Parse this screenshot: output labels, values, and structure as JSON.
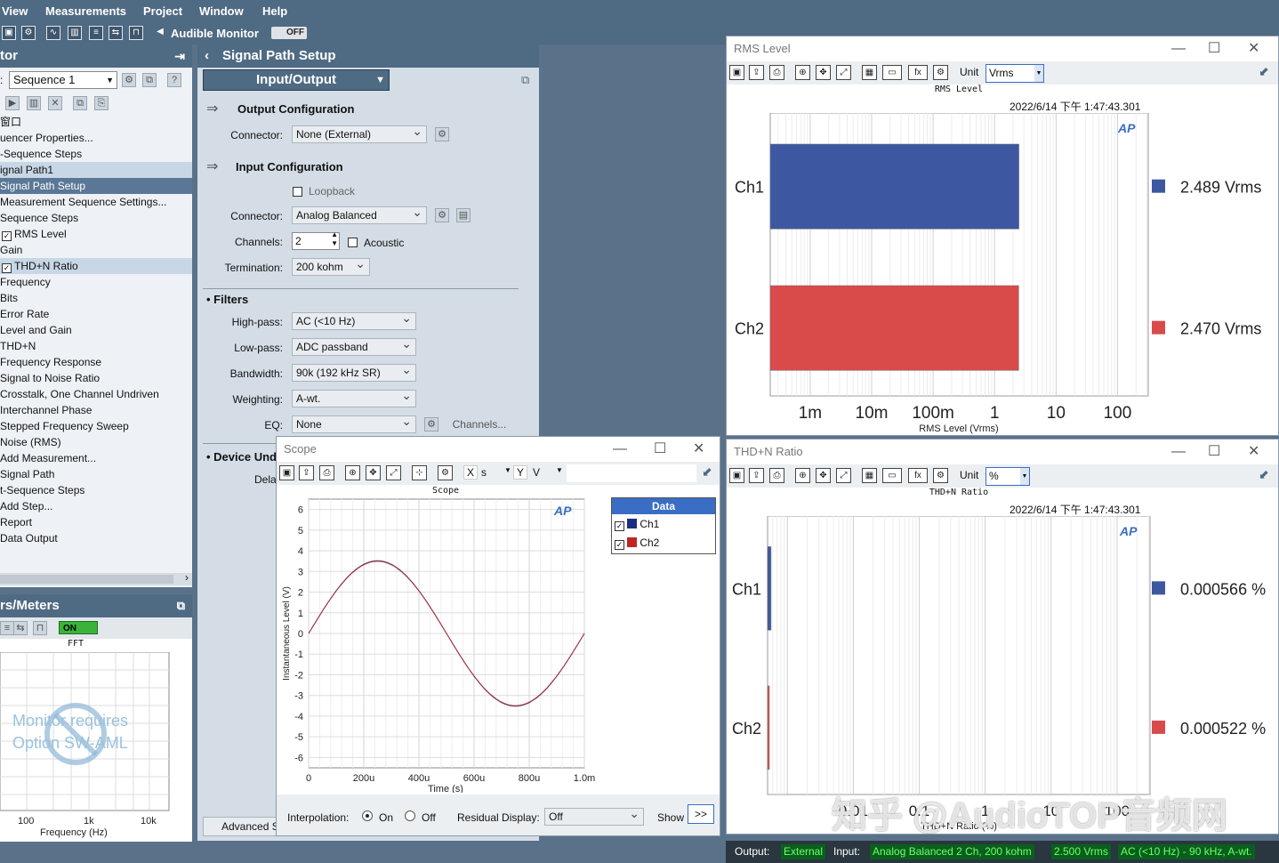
{
  "menu": {
    "items": [
      "View",
      "Measurements",
      "Project",
      "Window",
      "Help"
    ]
  },
  "toolbar": {
    "audible_monitor": "Audible Monitor",
    "off": "OFF"
  },
  "navigator": {
    "title": "tor",
    "sequence_label": ":",
    "sequence_value": "Sequence 1",
    "items": [
      {
        "text": "窗口",
        "cls": ""
      },
      {
        "text": "uencer Properties...",
        "cls": ""
      },
      {
        "text": "-Sequence Steps",
        "cls": ""
      },
      {
        "text": "ignal Path1",
        "cls": "sel"
      },
      {
        "text": "Signal Path Setup",
        "cls": "hl"
      },
      {
        "text": "Measurement Sequence Settings...",
        "cls": ""
      },
      {
        "text": "Sequence Steps",
        "cls": ""
      },
      {
        "text": "RMS Level",
        "cls": "",
        "check": true
      },
      {
        "text": "Gain",
        "cls": ""
      },
      {
        "text": "THD+N Ratio",
        "cls": "sel",
        "check": true
      },
      {
        "text": "Frequency",
        "cls": ""
      },
      {
        "text": "Bits",
        "cls": ""
      },
      {
        "text": "Error Rate",
        "cls": ""
      },
      {
        "text": "Level and Gain",
        "cls": ""
      },
      {
        "text": "THD+N",
        "cls": ""
      },
      {
        "text": "Frequency Response",
        "cls": ""
      },
      {
        "text": "Signal to Noise Ratio",
        "cls": ""
      },
      {
        "text": "Crosstalk, One Channel Undriven",
        "cls": ""
      },
      {
        "text": "Interchannel Phase",
        "cls": ""
      },
      {
        "text": "Stepped Frequency Sweep",
        "cls": ""
      },
      {
        "text": "Noise (RMS)",
        "cls": ""
      },
      {
        "text": "Add Measurement...",
        "cls": ""
      },
      {
        "text": "Signal Path",
        "cls": ""
      },
      {
        "text": "t-Sequence Steps",
        "cls": ""
      },
      {
        "text": "Add Step...",
        "cls": ""
      },
      {
        "text": "Report",
        "cls": ""
      },
      {
        "text": "Data Output",
        "cls": ""
      }
    ]
  },
  "meters": {
    "title": "rs/Meters",
    "on": "ON",
    "fft_title": "FFT",
    "warning_line1": "Monitor requires",
    "warning_line2": "Option SW-AML",
    "x_ticks": [
      "100",
      "1k",
      "10k"
    ],
    "xlabel": "Frequency (Hz)"
  },
  "signal_path": {
    "title": "Signal Path Setup",
    "io_select": "Input/Output",
    "output_config": "Output Configuration",
    "connector_label": "Connector:",
    "output_connector": "None (External)",
    "input_config": "Input Configuration",
    "loopback": "Loopback",
    "input_connector": "Analog Balanced",
    "channels_label": "Channels:",
    "channels_value": "2",
    "acoustic": "Acoustic",
    "termination_label": "Termination:",
    "termination_value": "200 kohm",
    "filters": "Filters",
    "highpass_label": "High-pass:",
    "highpass_value": "AC (<10 Hz)",
    "lowpass_label": "Low-pass:",
    "lowpass_value": "ADC passband",
    "bandwidth_label": "Bandwidth:",
    "bandwidth_value": "90k (192 kHz SR)",
    "weighting_label": "Weighting:",
    "weighting_value": "A-wt.",
    "eq_label": "EQ:",
    "eq_value": "None",
    "channels_btn": "Channels...",
    "device_under": "Device Und",
    "delay_label": "Dela",
    "advanced": "Advanced S"
  },
  "rms_window": {
    "title": "RMS Level",
    "unit_label": "Unit",
    "unit_value": "Vrms",
    "plot_title": "RMS Level",
    "timestamp": "2022/6/14 下午 1:47:43.301",
    "xlabel": "RMS Level (Vrms)"
  },
  "thd_window": {
    "title": "THD+N Ratio",
    "unit_label": "Unit",
    "unit_value": "%",
    "plot_title": "THD+N Ratio",
    "timestamp": "2022/6/14 下午 1:47:43.301",
    "xlabel": "THD+N Ratio (%)",
    "watermark": "知乎 @AudioTOP音频网"
  },
  "scope_window": {
    "title": "Scope",
    "plot_title": "Scope",
    "x_unit_label": "X",
    "x_unit": "s",
    "y_unit_label": "Y",
    "y_unit": "V",
    "ylabel": "Instantaneous Level (V)",
    "xlabel": "Time (s)",
    "legend_title": "Data",
    "legend": [
      "Ch1",
      "Ch2"
    ],
    "interpolation_label": "Interpolation:",
    "on": "On",
    "off": "Off",
    "residual_label": "Residual Display:",
    "residual_value": "Off",
    "show": "Show",
    "more": ">>"
  },
  "status": {
    "output_label": "Output:",
    "output_value": "External",
    "input_label": "Input:",
    "input_value": "Analog Balanced 2 Ch, 200 kohm",
    "level": "2.500 Vrms",
    "filter": "AC (<10 Hz) - 90 kHz, A-wt."
  },
  "chart_data": [
    {
      "type": "bar",
      "title": "RMS Level",
      "orientation": "horizontal",
      "categories": [
        "Ch1",
        "Ch2"
      ],
      "values": [
        2.489,
        2.47
      ],
      "value_labels": [
        "2.489 Vrms",
        "2.470 Vrms"
      ],
      "colors": [
        "#3d57a0",
        "#d94a4a"
      ],
      "xscale": "log",
      "xlim": [
        0.0001,
        316
      ],
      "x_ticks": [
        "1m",
        "10m",
        "100m",
        "1",
        "10",
        "100"
      ],
      "x_tick_values": [
        0.001,
        0.01,
        0.1,
        1,
        10,
        100
      ],
      "xlabel": "RMS Level (Vrms)"
    },
    {
      "type": "bar",
      "title": "THD+N Ratio",
      "orientation": "horizontal",
      "categories": [
        "Ch1",
        "Ch2"
      ],
      "values": [
        0.000566,
        0.000522
      ],
      "value_labels": [
        "0.000566 %",
        "0.000522 %"
      ],
      "colors": [
        "#3d57a0",
        "#d94a4a"
      ],
      "xscale": "log",
      "x_ticks": [
        "0.01",
        "0.1",
        "1",
        "10",
        "100"
      ],
      "xlabel": "THD+N Ratio (%)"
    },
    {
      "type": "line",
      "title": "Scope",
      "xlabel": "Time (s)",
      "ylabel": "Instantaneous Level (V)",
      "x_ticks": [
        "0",
        "200u",
        "400u",
        "600u",
        "800u",
        "1.0m"
      ],
      "y_ticks": [
        "6",
        "5",
        "4",
        "3",
        "2",
        "1",
        "0",
        "-1",
        "-2",
        "-3",
        "-4",
        "-5",
        "-6"
      ],
      "xlim": [
        0,
        0.001
      ],
      "ylim": [
        -6.5,
        6.5
      ],
      "series": [
        {
          "name": "Ch1",
          "color": "#1a2f80",
          "amplitude": 3.52,
          "frequency_hz": 1000
        },
        {
          "name": "Ch2",
          "color": "#c02424",
          "amplitude": 3.49,
          "frequency_hz": 1000
        }
      ]
    }
  ]
}
